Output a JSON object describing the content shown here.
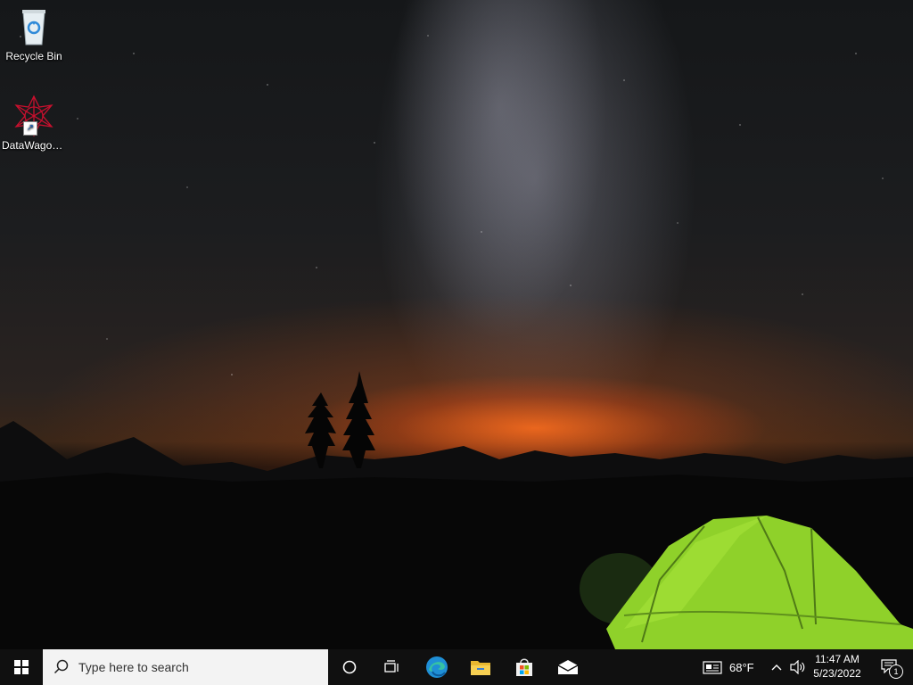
{
  "desktop": {
    "icons": [
      {
        "label": "Recycle Bin"
      },
      {
        "label": "DataWagon..."
      }
    ]
  },
  "taskbar": {
    "search_placeholder": "Type here to search",
    "weather": {
      "temp": "68°F"
    },
    "clock": {
      "time": "11:47 AM",
      "date": "5/23/2022"
    },
    "notifications": {
      "count": "1"
    }
  },
  "colors": {
    "taskbar_bg": "#101010",
    "search_bg": "#f3f3f3",
    "tent_green": "#8fd12a",
    "horizon_orange": "#ff6a1e"
  }
}
